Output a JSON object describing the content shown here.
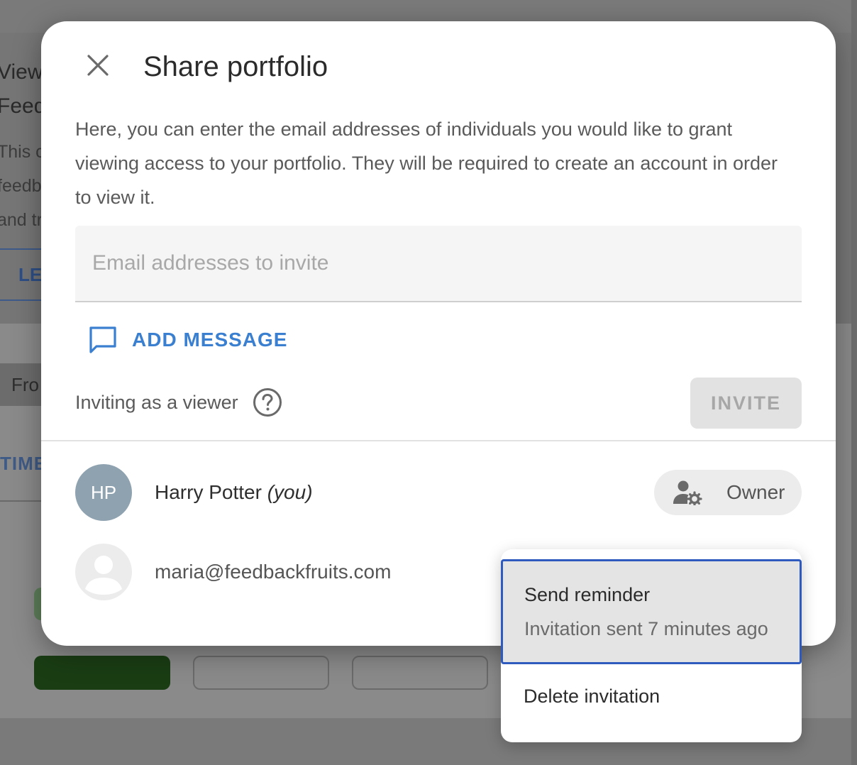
{
  "background": {
    "title_line1": "View",
    "title_line2": "Feed",
    "desc_line1": "This c",
    "desc_line2": "feedb",
    "desc_line3": "and tr",
    "learn_button": "LE",
    "filter_chip": "Fro",
    "tab_label": "TIME"
  },
  "dialog": {
    "title": "Share portfolio",
    "description": "Here, you can enter the email addresses of individuals you would like to grant viewing access to your portfolio. They will be required to create an account in order to view it.",
    "email_placeholder": "Email addresses to invite",
    "add_message_label": "ADD MESSAGE",
    "inviting_label": "Inviting as a viewer",
    "invite_button": "INVITE",
    "members": [
      {
        "initials": "HP",
        "name": "Harry Potter",
        "suffix": "(you)",
        "role": "Owner"
      },
      {
        "email": "maria@feedbackfruits.com"
      }
    ]
  },
  "menu": {
    "send_reminder": "Send reminder",
    "send_reminder_sub": "Invitation sent 7 minutes ago",
    "delete_invitation": "Delete invitation"
  },
  "colors": {
    "accent": "#3a7fd0",
    "avatar": "#8fa2b0",
    "menu_focus_border": "#2f5bbf"
  },
  "icons": {
    "close": "close-icon",
    "add_message": "chat-bubble-icon",
    "help": "help-circle-icon",
    "owner": "user-gear-icon",
    "avatar_placeholder": "person-icon"
  }
}
